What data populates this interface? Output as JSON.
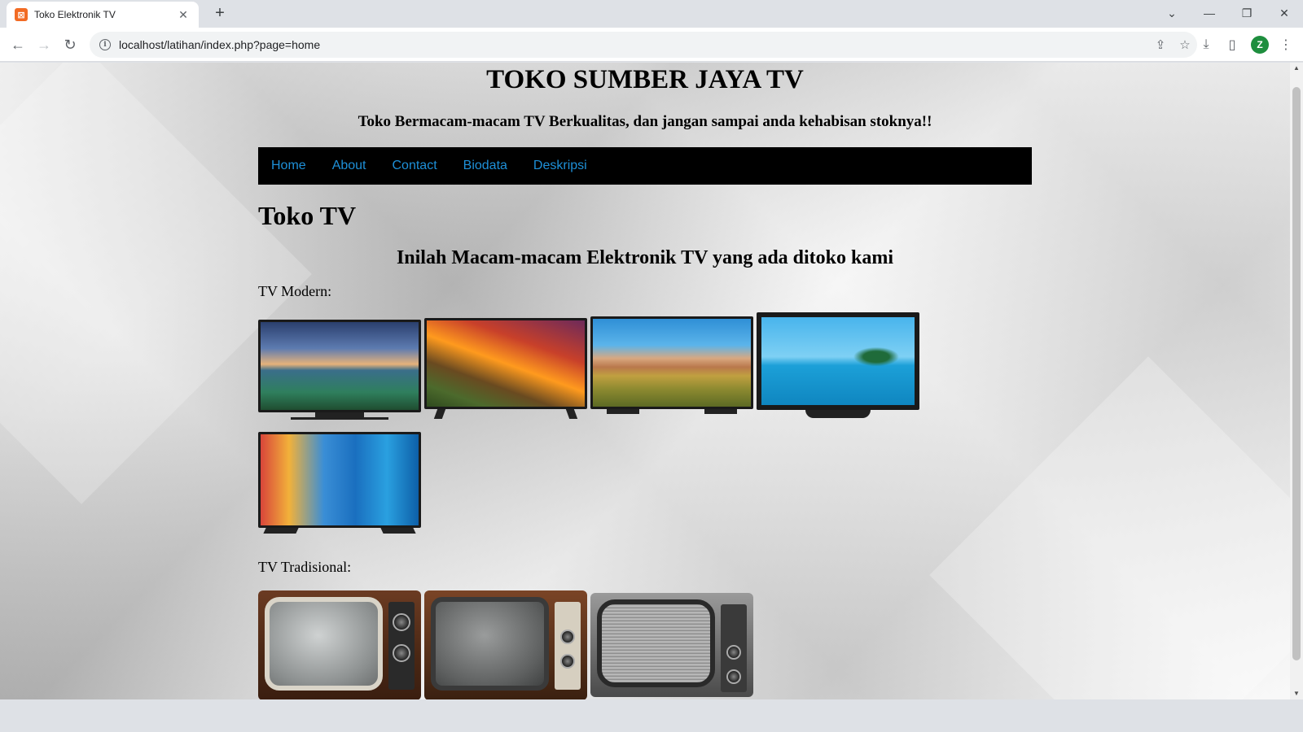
{
  "browser": {
    "tab_title": "Toko Elektronik TV",
    "favicon_letter": "⊠",
    "url": "localhost/latihan/index.php?page=home",
    "profile_initial": "Z"
  },
  "site": {
    "title": "TOKO SUMBER JAYA TV",
    "tagline": "Toko Bermacam-macam TV Berkualitas, dan jangan sampai anda kehabisan stoknya!!",
    "nav": [
      {
        "label": "Home"
      },
      {
        "label": "About"
      },
      {
        "label": "Contact"
      },
      {
        "label": "Biodata"
      },
      {
        "label": "Deskripsi"
      }
    ],
    "nav_color": "#1e90d8"
  },
  "content": {
    "heading": "Toko TV",
    "subheading": "Inilah Macam-macam Elektronik TV yang ada ditoko kami",
    "modern_label": "TV Modern:",
    "traditional_label": "TV Tradisional:",
    "modern_tvs": [
      {
        "scene": "coastal sunset landscape"
      },
      {
        "scene": "orange sunset over cliff waterfall"
      },
      {
        "scene": "desert canyon and grass field"
      },
      {
        "scene": "tropical palm island in turquoise sea"
      },
      {
        "scene": "colorful cliffside village by the sea"
      }
    ],
    "traditional_tvs": [
      {
        "style": "wooden cabinet CRT with two knobs"
      },
      {
        "style": "wooden cabinet CRT with control panel"
      },
      {
        "style": "silver CRT with static screen"
      }
    ]
  }
}
